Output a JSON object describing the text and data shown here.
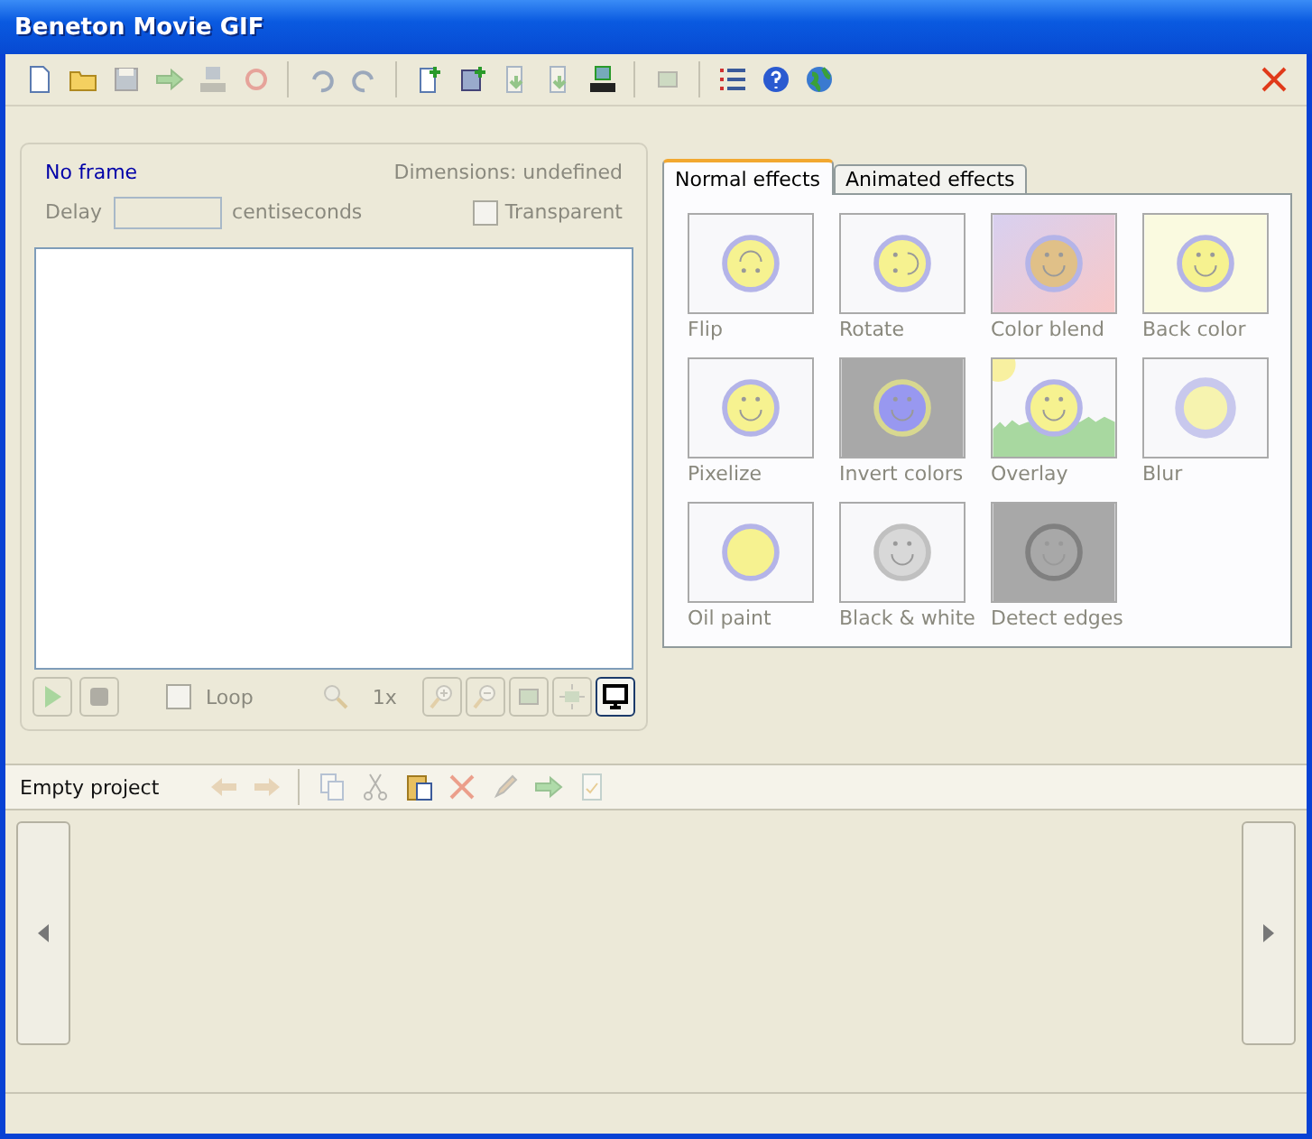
{
  "window": {
    "title": "Beneton Movie GIF"
  },
  "toolbar": [
    {
      "kind": "new",
      "disabled": false
    },
    {
      "kind": "open",
      "disabled": false
    },
    {
      "kind": "save",
      "disabled": true
    },
    {
      "kind": "export",
      "disabled": true
    },
    {
      "kind": "save-number",
      "disabled": true
    },
    {
      "kind": "reload",
      "disabled": true
    },
    {
      "kind": "sep"
    },
    {
      "kind": "undo",
      "disabled": true
    },
    {
      "kind": "redo",
      "disabled": true
    },
    {
      "kind": "sep"
    },
    {
      "kind": "add-frame",
      "disabled": false
    },
    {
      "kind": "add-image",
      "disabled": false
    },
    {
      "kind": "insert",
      "disabled": true
    },
    {
      "kind": "insert-image",
      "disabled": true
    },
    {
      "kind": "number",
      "disabled": false
    },
    {
      "kind": "sep"
    },
    {
      "kind": "fit",
      "disabled": true
    },
    {
      "kind": "sep"
    },
    {
      "kind": "list",
      "disabled": false
    },
    {
      "kind": "help",
      "disabled": false
    },
    {
      "kind": "globe",
      "disabled": false
    }
  ],
  "frame_panel": {
    "frame_label": "No frame",
    "dimensions": "Dimensions: undefined",
    "delay_label": "Delay",
    "delay_unit": "centiseconds",
    "transparent": {
      "label": "Transparent",
      "checked": false
    },
    "player": [
      {
        "kind": "play",
        "disabled": true
      },
      {
        "kind": "stop",
        "disabled": true
      }
    ],
    "loop": {
      "label": "Loop",
      "checked": false
    },
    "zoom": "1x",
    "view_buttons": [
      {
        "kind": "zoom-in",
        "selected": false
      },
      {
        "kind": "zoom-out",
        "selected": false
      },
      {
        "kind": "fit",
        "selected": false
      },
      {
        "kind": "center",
        "selected": false
      },
      {
        "kind": "screen",
        "selected": true
      }
    ]
  },
  "tabs": [
    {
      "label": "Normal effects",
      "selected": true
    },
    {
      "label": "Animated effects",
      "selected": false
    }
  ],
  "effects": [
    {
      "label": "Flip",
      "kind": "flip"
    },
    {
      "label": "Rotate",
      "kind": "rotate"
    },
    {
      "label": "Color blend",
      "kind": "blend"
    },
    {
      "label": "Back color",
      "kind": "backcolor"
    },
    {
      "label": "Pixelize",
      "kind": "pixelize"
    },
    {
      "label": "Invert colors",
      "kind": "invert"
    },
    {
      "label": "Overlay",
      "kind": "overlay"
    },
    {
      "label": "Blur",
      "kind": "blur"
    },
    {
      "label": "Oil paint",
      "kind": "oil"
    },
    {
      "label": "Black & white",
      "kind": "bw"
    },
    {
      "label": "Detect edges",
      "kind": "edges"
    }
  ],
  "project": {
    "title": "Empty project",
    "toolbar": [
      {
        "kind": "back",
        "disabled": true
      },
      {
        "kind": "forward",
        "disabled": true
      },
      {
        "kind": "sep"
      },
      {
        "kind": "copy",
        "disabled": true
      },
      {
        "kind": "cut",
        "disabled": true
      },
      {
        "kind": "paste",
        "disabled": false
      },
      {
        "kind": "delete",
        "disabled": true
      },
      {
        "kind": "edit",
        "disabled": true
      },
      {
        "kind": "export",
        "disabled": true
      },
      {
        "kind": "check",
        "disabled": true
      }
    ]
  }
}
